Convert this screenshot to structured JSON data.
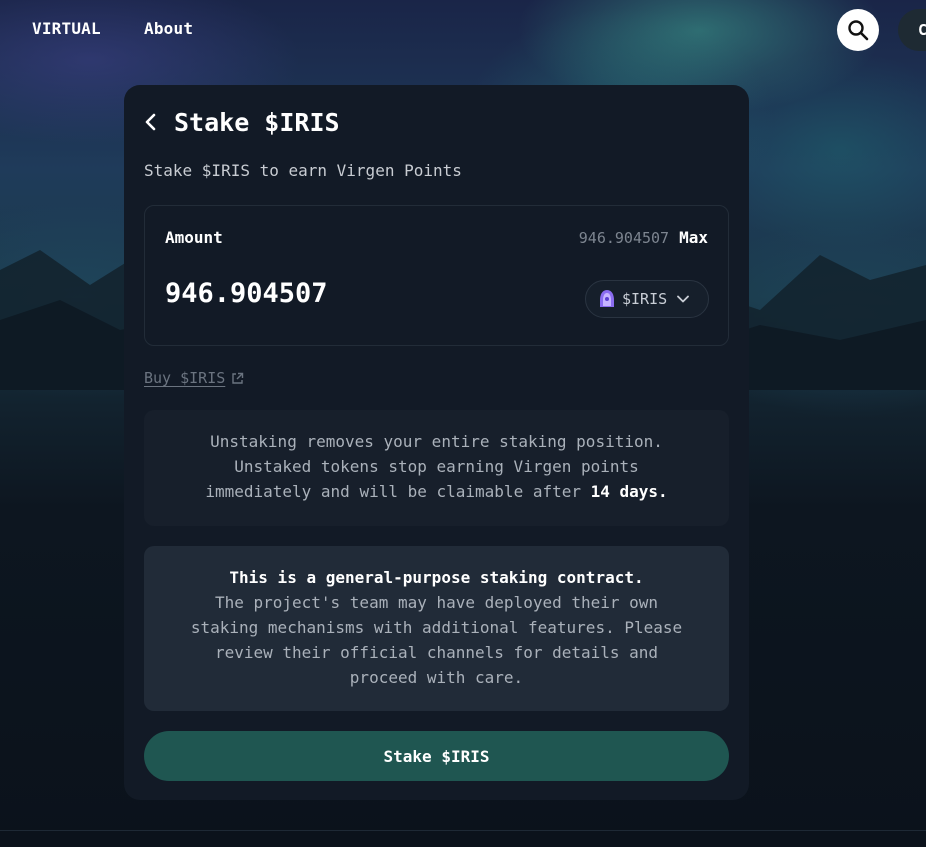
{
  "nav": {
    "virtual_label": "VIRTUAL",
    "about_label": "About",
    "right_pill_label": "C"
  },
  "modal": {
    "title": "Stake $IRIS",
    "subtitle": "Stake $IRIS to earn Virgen Points",
    "amount": {
      "label": "Amount",
      "balance": "946.904507",
      "max_label": "Max",
      "value": "946.904507",
      "token": "$IRIS"
    },
    "buy_link": "Buy $IRIS",
    "info": {
      "line1": "Unstaking removes your entire staking position.",
      "line2": "Unstaked tokens stop earning Virgen points",
      "line3_prefix": "immediately and will be claimable after ",
      "line3_strong": "14 days."
    },
    "warning": {
      "title": "This is a general-purpose staking contract.",
      "line1": "The project's team may have deployed their own",
      "line2": "staking mechanisms with additional features. Please",
      "line3": "review their official channels for details and",
      "line4": "proceed with care."
    },
    "submit_label": "Stake $IRIS"
  },
  "icons": {
    "search": "search-icon",
    "back": "chevron-left-icon",
    "token": "iris-token-icon",
    "dropdown": "chevron-down-icon",
    "external": "external-link-icon"
  },
  "colors": {
    "modal_bg": "#121a26",
    "button_bg": "#1f5651",
    "warning_bg": "#212b38",
    "info_bg": "#171f2b"
  }
}
